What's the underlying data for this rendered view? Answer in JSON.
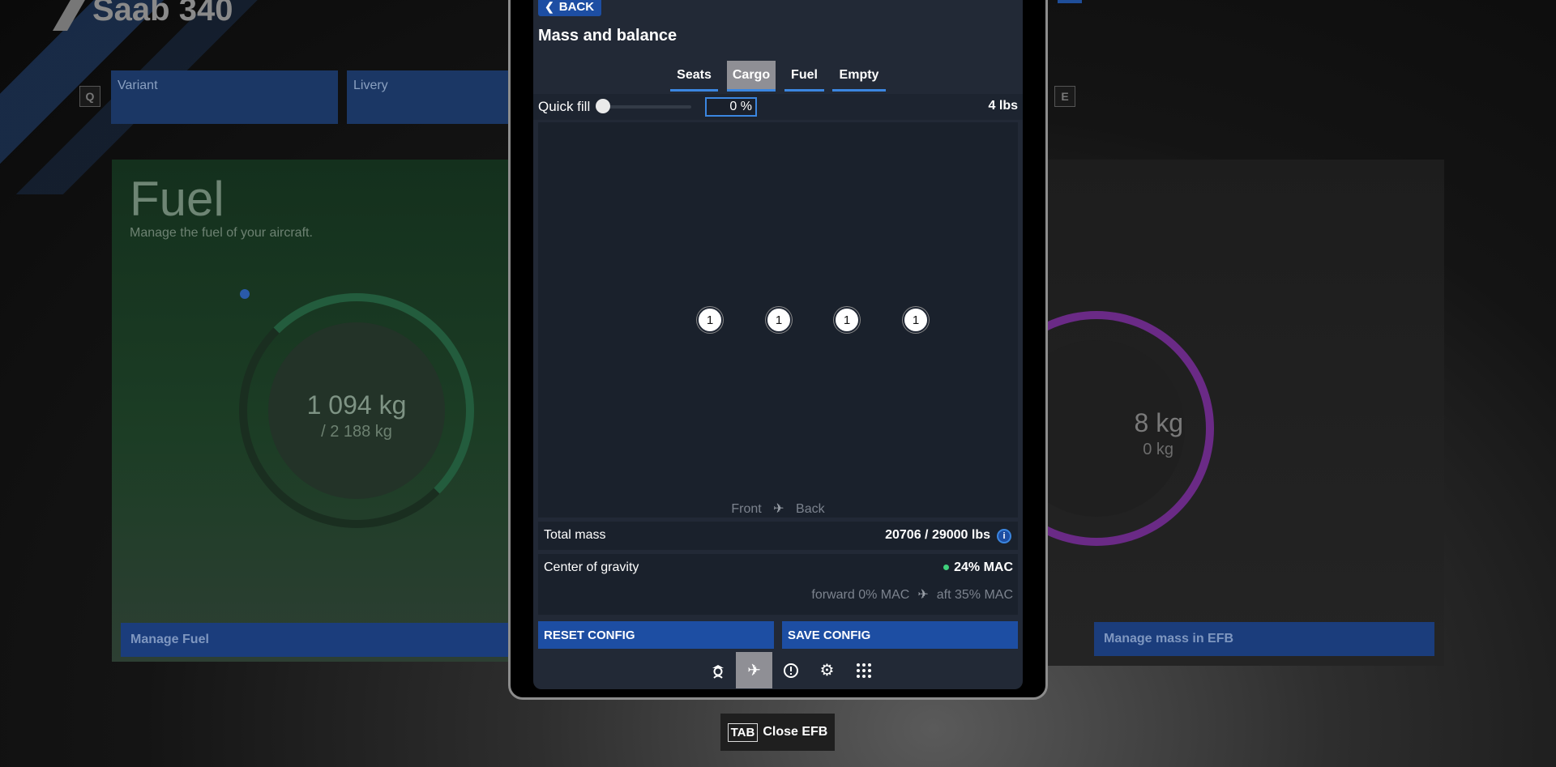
{
  "background": {
    "app_title": "Saab 340",
    "key_left": "Q",
    "key_right": "E",
    "variant_label": "Variant",
    "livery_label": "Livery",
    "fuel_card": {
      "title": "Fuel",
      "subtitle": "Manage the fuel of your aircraft.",
      "value": "1 094 kg",
      "capacity": "/ 2 188 kg",
      "button": "Manage Fuel"
    },
    "mass_card": {
      "value_partial": "8 kg",
      "capacity_partial": "0 kg",
      "button": "Manage mass in EFB"
    }
  },
  "efb": {
    "back_label": "BACK",
    "title": "Mass and balance",
    "tabs": [
      {
        "label": "Seats",
        "active": false
      },
      {
        "label": "Cargo",
        "active": true
      },
      {
        "label": "Fuel",
        "active": false
      },
      {
        "label": "Empty",
        "active": false
      }
    ],
    "quick_fill": {
      "label": "Quick fill",
      "percent": 0,
      "input_value": "0 %",
      "weight": "4 lbs"
    },
    "cargo_slots": [
      "1",
      "1",
      "1",
      "1"
    ],
    "orientation": {
      "front": "Front",
      "back": "Back"
    },
    "total_mass": {
      "label": "Total mass",
      "value": "20706 / 29000 lbs",
      "info_icon": "info-icon"
    },
    "center_of_gravity": {
      "label": "Center of gravity",
      "value": "24% MAC",
      "status_color": "#3fd07c",
      "forward": "forward 0% MAC",
      "aft": "aft 35% MAC"
    },
    "buttons": {
      "reset": "RESET CONFIG",
      "save": "SAVE CONFIG"
    },
    "toolbar": [
      {
        "icon": "pilot-icon",
        "active": false
      },
      {
        "icon": "airplane-icon",
        "active": true
      },
      {
        "icon": "alert-icon",
        "active": false
      },
      {
        "icon": "gear-icon",
        "active": false
      },
      {
        "icon": "apps-grid-icon",
        "active": false
      }
    ]
  },
  "close_hint": {
    "key": "TAB",
    "label": "Close EFB"
  },
  "colors": {
    "accent": "#1d4ea3",
    "tab_underline": "#3b86e0",
    "screen_bg": "#222936"
  }
}
